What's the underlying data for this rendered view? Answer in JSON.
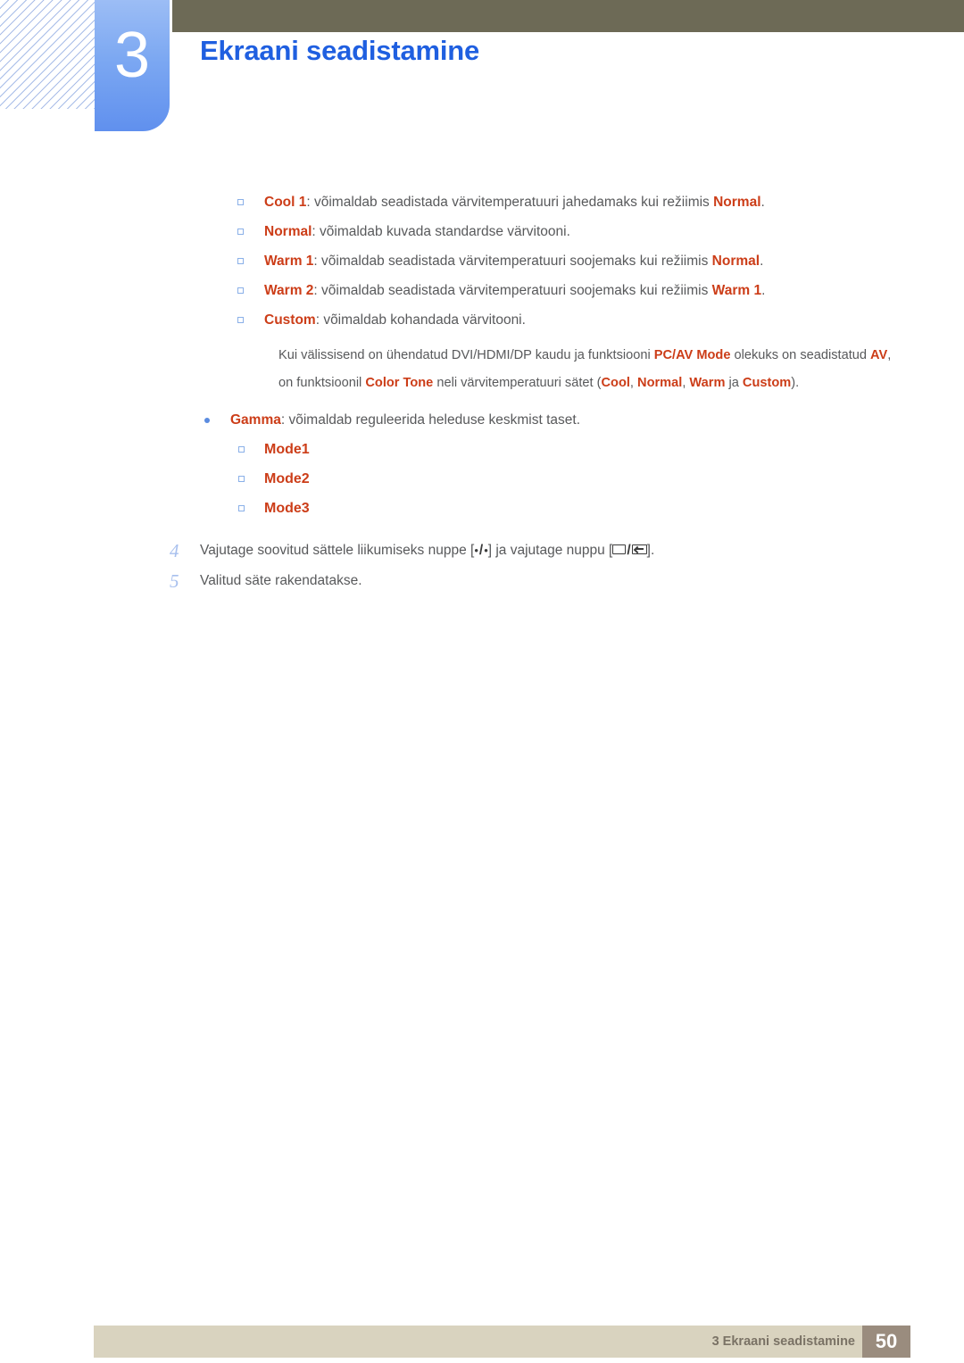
{
  "header": {
    "chapter_number": "3",
    "chapter_title": "Ekraani seadistamine",
    "title_color": "#1f5fe0",
    "badge_color": "#7ca8f2",
    "bar_color": "#6d6a56"
  },
  "accent_color": "#cc3d18",
  "body_color": "#58595b",
  "color_tone_options": [
    {
      "term": "Cool 1",
      "desc_before": ": võimaldab seadistada värvitemperatuuri jahedamaks kui režiimis ",
      "ref": "Normal",
      "desc_after": "."
    },
    {
      "term": "Normal",
      "desc_before": ": võimaldab kuvada standardse värvitooni.",
      "ref": "",
      "desc_after": ""
    },
    {
      "term": "Warm 1",
      "desc_before": ": võimaldab seadistada värvitemperatuuri soojemaks kui režiimis ",
      "ref": "Normal",
      "desc_after": "."
    },
    {
      "term": "Warm 2",
      "desc_before": ": võimaldab seadistada värvitemperatuuri soojemaks kui režiimis ",
      "ref": "Warm 1",
      "desc_after": "."
    },
    {
      "term": "Custom",
      "desc_before": ": võimaldab kohandada värvitooni.",
      "ref": "",
      "desc_after": ""
    }
  ],
  "note": {
    "p1": "Kui välissisend on ühendatud DVI/HDMI/DP kaudu ja funktsiooni ",
    "k1": "PC/AV Mode",
    "p2": " olekuks on seadistatud ",
    "k2": "AV",
    "p3": ", on funktsioonil ",
    "k3": "Color Tone",
    "p4": " neli värvitemperatuuri sätet (",
    "k4": "Cool",
    "p5": ", ",
    "k5": "Normal",
    "p6": ", ",
    "k6": "Warm",
    "p7": " ja ",
    "k7": "Custom",
    "p8": ")."
  },
  "gamma": {
    "term": "Gamma",
    "desc": ": võimaldab reguleerida heleduse keskmist taset.",
    "modes": [
      "Mode1",
      "Mode2",
      "Mode3"
    ]
  },
  "steps": [
    {
      "number": "4",
      "text_a": "Vajutage soovitud sättele liikumiseks nuppe [",
      "text_b": "] ja vajutage nuppu [",
      "text_c": "].",
      "dot_glyph": "•",
      "slash": "/",
      "menu_icon": "menu-button-icon",
      "enter_icon": "enter-button-icon"
    },
    {
      "number": "5",
      "text_a": "Valitud säte rakendatakse.",
      "text_b": "",
      "text_c": ""
    }
  ],
  "footer": {
    "label": "3 Ekraani seadistamine",
    "page_number": "50",
    "bar_color": "#d9d3bf",
    "page_box_color": "#9a8c7e"
  }
}
